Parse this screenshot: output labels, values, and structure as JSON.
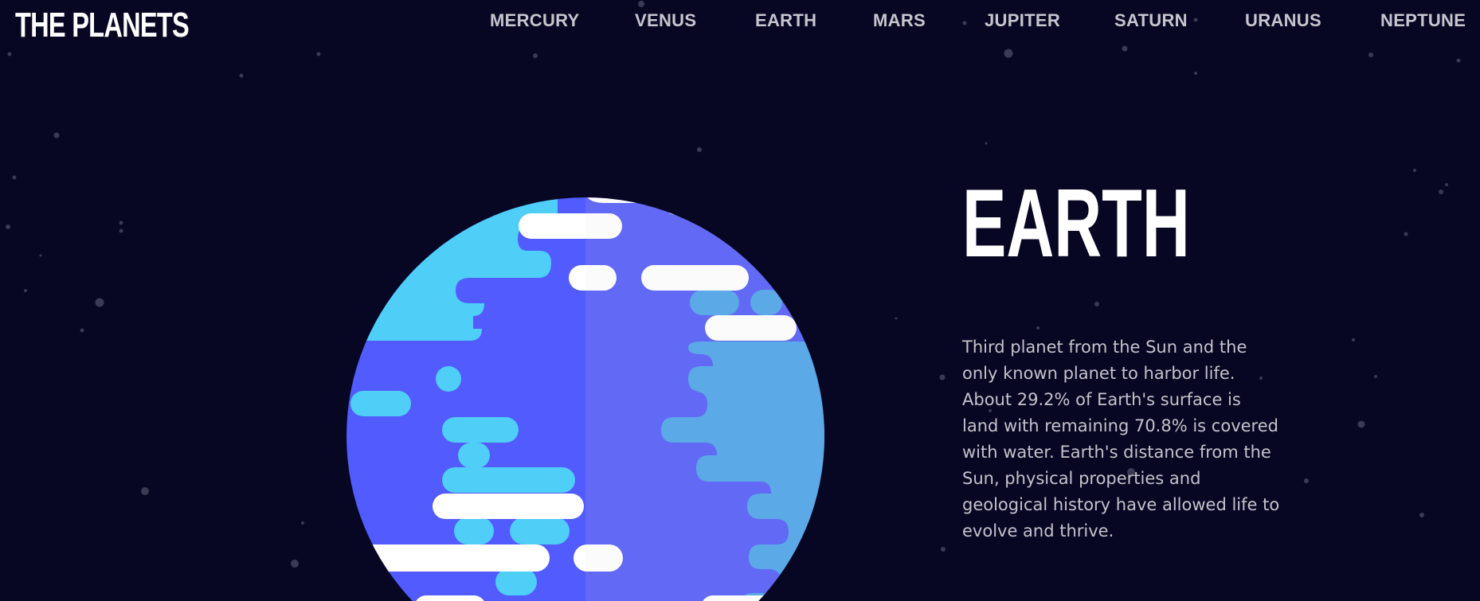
{
  "site": {
    "logo_text": "THE PLANETS"
  },
  "nav": {
    "items": [
      {
        "label": "MERCURY"
      },
      {
        "label": "VENUS"
      },
      {
        "label": "EARTH"
      },
      {
        "label": "MARS"
      },
      {
        "label": "JUPITER"
      },
      {
        "label": "SATURN"
      },
      {
        "label": "URANUS"
      },
      {
        "label": "NEPTUNE"
      }
    ]
  },
  "planet": {
    "name": "EARTH",
    "description": "Third planet from the Sun and the only known planet to harbor life. About 29.2% of Earth's surface is land with remaining 70.8% is covered with water. Earth's distance from the Sun, physical properties and geological history have allowed life to evolve and thrive.",
    "illustration_icon": "earth-icon"
  },
  "colors": {
    "background": "#070724",
    "ocean": "#525bfd",
    "ocean_shade": "#4b53e8",
    "land": "#4fcef8",
    "land_shade": "#49bce6",
    "cloud": "#ffffff",
    "cloud_shade": "#e8e8ee",
    "nav_text": "#c6c6cf",
    "body_text": "#c3c3cc"
  }
}
